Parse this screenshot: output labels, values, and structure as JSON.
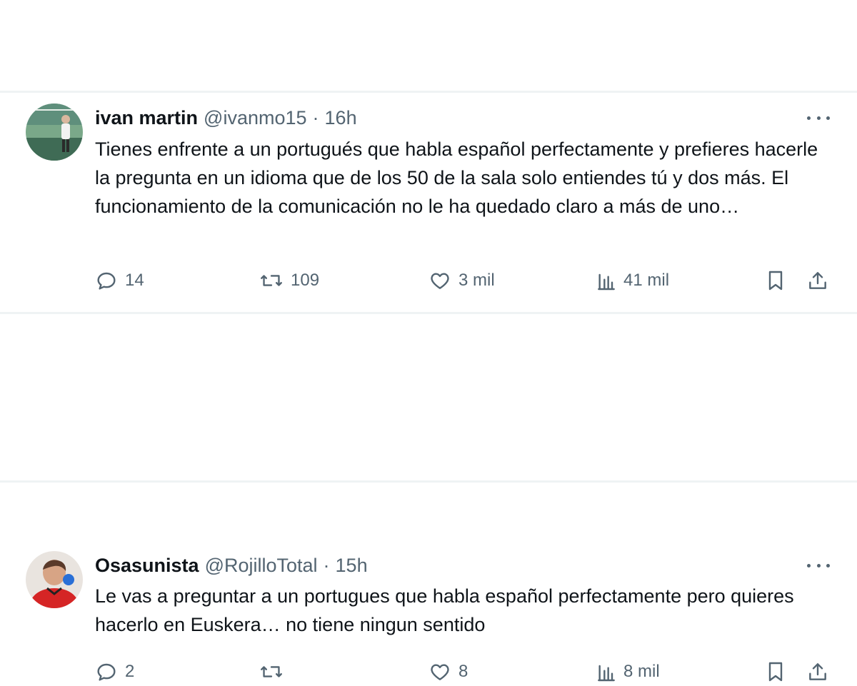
{
  "tweets": [
    {
      "display_name": "ivan martin",
      "handle": "@ivanmo15",
      "separator": "·",
      "time": "16h",
      "text": "Tienes enfrente a un portugués que habla español perfectamente y prefieres hacerle la pregunta en un idioma que de los 50 de la sala solo entiendes tú y dos más. El funcionamiento de la comunicación no le ha quedado claro a más de uno…",
      "replies": "14",
      "retweets": "109",
      "likes": "3 mil",
      "views": "41 mil",
      "avatar_icon": "user-photo-court"
    },
    {
      "display_name": "Osasunista",
      "handle": "@RojilloTotal",
      "separator": "·",
      "time": "15h",
      "text": "Le vas a preguntar a un portugues que habla español perfectamente pero quieres hacerlo en Euskera… no tiene ningun sentido",
      "replies": "2",
      "retweets": "",
      "likes": "8",
      "views": "8 mil",
      "avatar_icon": "user-photo-red-jersey"
    }
  ],
  "icons": {
    "reply": "reply-icon",
    "retweet": "retweet-icon",
    "like": "like-icon",
    "views": "views-icon",
    "bookmark": "bookmark-icon",
    "share": "share-icon",
    "more": "more-icon"
  },
  "colors": {
    "text_primary": "#0f1419",
    "text_secondary": "#536471",
    "divider": "#eff3f4"
  }
}
